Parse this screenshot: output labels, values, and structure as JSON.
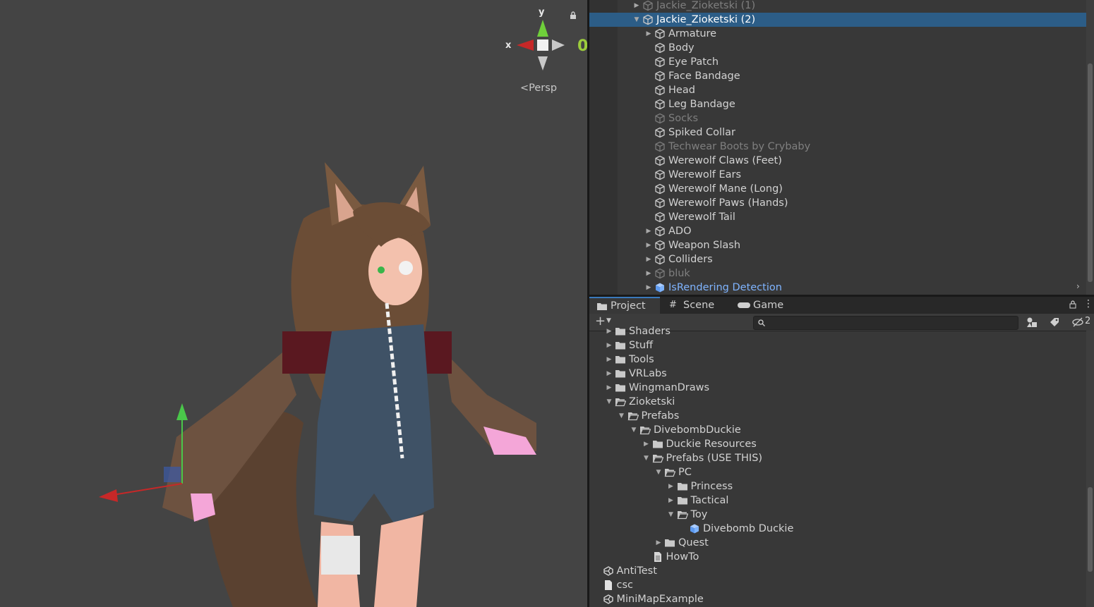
{
  "scene": {
    "gizmo": {
      "y_label": "y",
      "x_label": "x",
      "lock_icon": "lock-icon",
      "mode_label": "Persp"
    }
  },
  "hierarchy": {
    "rows": [
      {
        "label": "Jackie_Zioketski (1)",
        "depth": 0,
        "arrow": "collapsed",
        "icon": "gameobject-cube-icon",
        "style": "dim"
      },
      {
        "label": "Jackie_Zioketski (2)",
        "depth": 0,
        "arrow": "expanded",
        "icon": "gameobject-cube-icon",
        "style": "selected"
      },
      {
        "label": "Armature",
        "depth": 1,
        "arrow": "collapsed",
        "icon": "gameobject-cube-icon",
        "style": "normal"
      },
      {
        "label": "Body",
        "depth": 1,
        "arrow": "none",
        "icon": "gameobject-cube-icon",
        "style": "normal"
      },
      {
        "label": "Eye Patch",
        "depth": 1,
        "arrow": "none",
        "icon": "gameobject-cube-icon",
        "style": "normal"
      },
      {
        "label": "Face Bandage",
        "depth": 1,
        "arrow": "none",
        "icon": "gameobject-cube-icon",
        "style": "normal"
      },
      {
        "label": "Head",
        "depth": 1,
        "arrow": "none",
        "icon": "gameobject-cube-icon",
        "style": "normal"
      },
      {
        "label": "Leg Bandage",
        "depth": 1,
        "arrow": "none",
        "icon": "gameobject-cube-icon",
        "style": "normal"
      },
      {
        "label": "Socks",
        "depth": 1,
        "arrow": "none",
        "icon": "gameobject-cube-icon",
        "style": "dim"
      },
      {
        "label": "Spiked Collar",
        "depth": 1,
        "arrow": "none",
        "icon": "gameobject-cube-icon",
        "style": "normal"
      },
      {
        "label": "Techwear Boots by Crybaby",
        "depth": 1,
        "arrow": "none",
        "icon": "gameobject-cube-icon",
        "style": "dim"
      },
      {
        "label": "Werewolf Claws (Feet)",
        "depth": 1,
        "arrow": "none",
        "icon": "gameobject-cube-icon",
        "style": "normal"
      },
      {
        "label": "Werewolf Ears",
        "depth": 1,
        "arrow": "none",
        "icon": "gameobject-cube-icon",
        "style": "normal"
      },
      {
        "label": "Werewolf Mane (Long)",
        "depth": 1,
        "arrow": "none",
        "icon": "gameobject-cube-icon",
        "style": "normal"
      },
      {
        "label": "Werewolf Paws (Hands)",
        "depth": 1,
        "arrow": "none",
        "icon": "gameobject-cube-icon",
        "style": "normal"
      },
      {
        "label": "Werewolf Tail",
        "depth": 1,
        "arrow": "none",
        "icon": "gameobject-cube-icon",
        "style": "normal"
      },
      {
        "label": "ADO",
        "depth": 1,
        "arrow": "collapsed",
        "icon": "gameobject-cube-icon",
        "style": "normal"
      },
      {
        "label": "Weapon Slash",
        "depth": 1,
        "arrow": "collapsed",
        "icon": "gameobject-cube-icon",
        "style": "normal"
      },
      {
        "label": "Colliders",
        "depth": 1,
        "arrow": "collapsed",
        "icon": "gameobject-cube-icon",
        "style": "normal"
      },
      {
        "label": "bluk",
        "depth": 1,
        "arrow": "collapsed",
        "icon": "gameobject-cube-icon",
        "style": "dim"
      },
      {
        "label": "IsRendering Detection",
        "depth": 1,
        "arrow": "collapsed",
        "icon": "prefab-cube-icon",
        "style": "prefab"
      }
    ]
  },
  "project": {
    "tabs": [
      {
        "label": "Project",
        "icon": "folder-icon",
        "active": true
      },
      {
        "label": "Scene",
        "icon": "grid-hash-icon",
        "active": false
      },
      {
        "label": "Game",
        "icon": "gamepad-icon",
        "active": false
      }
    ],
    "toolbar": {
      "add_label": "+",
      "hidden_count": "2"
    },
    "rows": [
      {
        "label": "Shaders",
        "depth": 0,
        "arrow": "collapsed",
        "icon": "folder-icon"
      },
      {
        "label": "Stuff",
        "depth": 0,
        "arrow": "collapsed",
        "icon": "folder-icon"
      },
      {
        "label": "Tools",
        "depth": 0,
        "arrow": "collapsed",
        "icon": "folder-icon"
      },
      {
        "label": "VRLabs",
        "depth": 0,
        "arrow": "collapsed",
        "icon": "folder-icon"
      },
      {
        "label": "WingmanDraws",
        "depth": 0,
        "arrow": "collapsed",
        "icon": "folder-icon"
      },
      {
        "label": "Zioketski",
        "depth": 0,
        "arrow": "expanded",
        "icon": "folder-open-icon"
      },
      {
        "label": "Prefabs",
        "depth": 1,
        "arrow": "expanded",
        "icon": "folder-open-icon"
      },
      {
        "label": "DivebombDuckie",
        "depth": 2,
        "arrow": "expanded",
        "icon": "folder-open-icon"
      },
      {
        "label": "Duckie Resources",
        "depth": 3,
        "arrow": "collapsed",
        "icon": "folder-icon"
      },
      {
        "label": "Prefabs (USE THIS)",
        "depth": 3,
        "arrow": "expanded",
        "icon": "folder-open-icon"
      },
      {
        "label": "PC",
        "depth": 4,
        "arrow": "expanded",
        "icon": "folder-open-icon"
      },
      {
        "label": "Princess",
        "depth": 5,
        "arrow": "collapsed",
        "icon": "folder-icon"
      },
      {
        "label": "Tactical",
        "depth": 5,
        "arrow": "collapsed",
        "icon": "folder-icon"
      },
      {
        "label": "Toy",
        "depth": 5,
        "arrow": "expanded",
        "icon": "folder-open-icon"
      },
      {
        "label": "Divebomb Duckie",
        "depth": 6,
        "arrow": "none",
        "icon": "prefab-cube-icon"
      },
      {
        "label": "Quest",
        "depth": 4,
        "arrow": "collapsed",
        "icon": "folder-icon"
      },
      {
        "label": "HowTo",
        "depth": 3,
        "arrow": "none",
        "icon": "text-file-icon"
      },
      {
        "label": "AntiTest",
        "depth": -1,
        "arrow": "none",
        "icon": "unity-scene-icon"
      },
      {
        "label": "csc",
        "depth": -1,
        "arrow": "none",
        "icon": "file-icon"
      },
      {
        "label": "MiniMapExample",
        "depth": -1,
        "arrow": "none",
        "icon": "unity-scene-icon"
      }
    ]
  }
}
